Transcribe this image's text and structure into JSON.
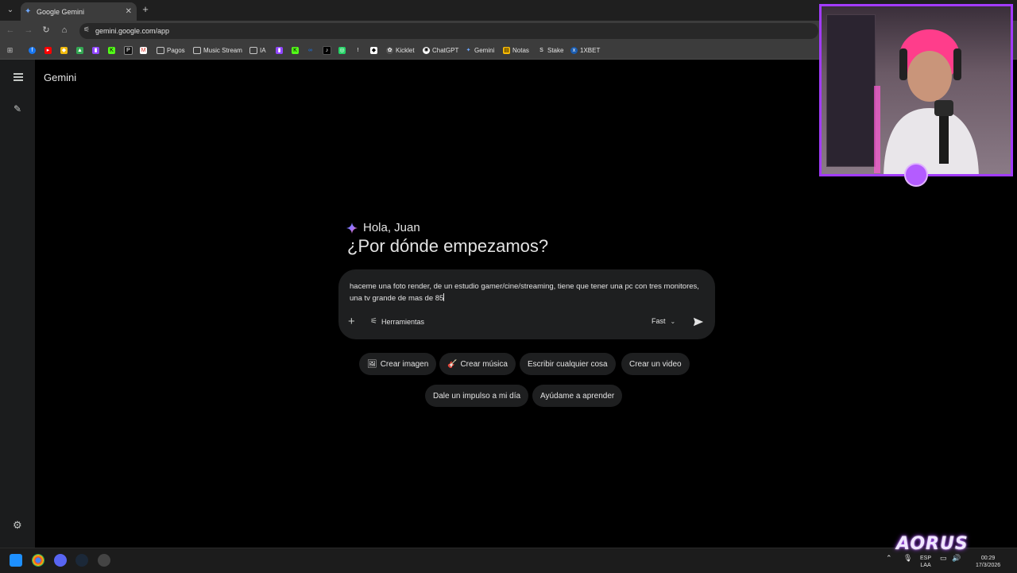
{
  "browser": {
    "tab_title": "Google Gemini",
    "url": "gemini.google.com/app",
    "bookmarks": [
      "Pagos",
      "Music Stream",
      "IA",
      "Kicklet",
      "ChatGPT",
      "Gemini",
      "Notas",
      "Stake",
      "1XBET"
    ]
  },
  "gemini": {
    "app_title": "Gemini",
    "greeting": "Hola, Juan",
    "headline": "¿Por dónde empezamos?",
    "prompt_value": "haceme una foto render, de un estudio gamer/cine/streaming, tiene que tener una pc con tres monitores, una tv grande de mas de 85",
    "tools_label": "Herramientas",
    "model_label": "Fast",
    "chips": [
      {
        "emoji": "🖼",
        "label": "Crear imagen"
      },
      {
        "emoji": "🎸",
        "label": "Crear música"
      },
      {
        "emoji": "",
        "label": "Escribir cualquier cosa"
      },
      {
        "emoji": "",
        "label": "Crear un video"
      },
      {
        "emoji": "",
        "label": "Dale un impulso a mi día"
      },
      {
        "emoji": "",
        "label": "Ayúdame a aprender"
      }
    ]
  },
  "taskbar": {
    "lang_top": "ESP",
    "lang_bottom": "LAA",
    "time": "00:29",
    "date": "17/3/2026",
    "brand": "AORUS"
  },
  "colors": {
    "cam_border": "#a23bff",
    "prompt_bg": "#1e1f20",
    "sidebar_bg": "#1b1c1d"
  }
}
